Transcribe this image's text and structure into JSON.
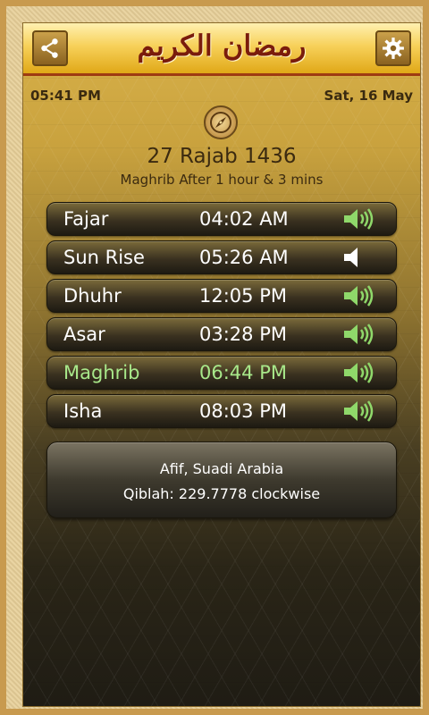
{
  "header": {
    "title": "رمضان الكريم"
  },
  "status": {
    "time": "05:41 PM",
    "date": "Sat, 16 May"
  },
  "hijri_date": "27 Rajab 1436",
  "next_prayer": "Maghrib After 1 hour & 3 mins",
  "prayers": [
    {
      "name": "Fajar",
      "time": "04:02 AM",
      "sound": "speaker-on-icon"
    },
    {
      "name": "Sun Rise",
      "time": "05:26 AM",
      "sound": "speaker-muted-icon"
    },
    {
      "name": "Dhuhr",
      "time": "12:05 PM",
      "sound": "speaker-on-icon"
    },
    {
      "name": "Asar",
      "time": "03:28 PM",
      "sound": "speaker-on-icon"
    },
    {
      "name": "Maghrib",
      "time": "06:44 PM",
      "sound": "speaker-on-icon",
      "active": true
    },
    {
      "name": "Isha",
      "time": "08:03 PM",
      "sound": "speaker-on-icon"
    }
  ],
  "location": {
    "place": "Afif, Suadi Arabia",
    "qiblah": "Qiblah: 229.7778 clockwise"
  },
  "colors": {
    "title": "#7a1c0c",
    "active_prayer": "#a8e88a",
    "speaker_on": "#8fd86a",
    "speaker_muted": "#ffffff"
  }
}
